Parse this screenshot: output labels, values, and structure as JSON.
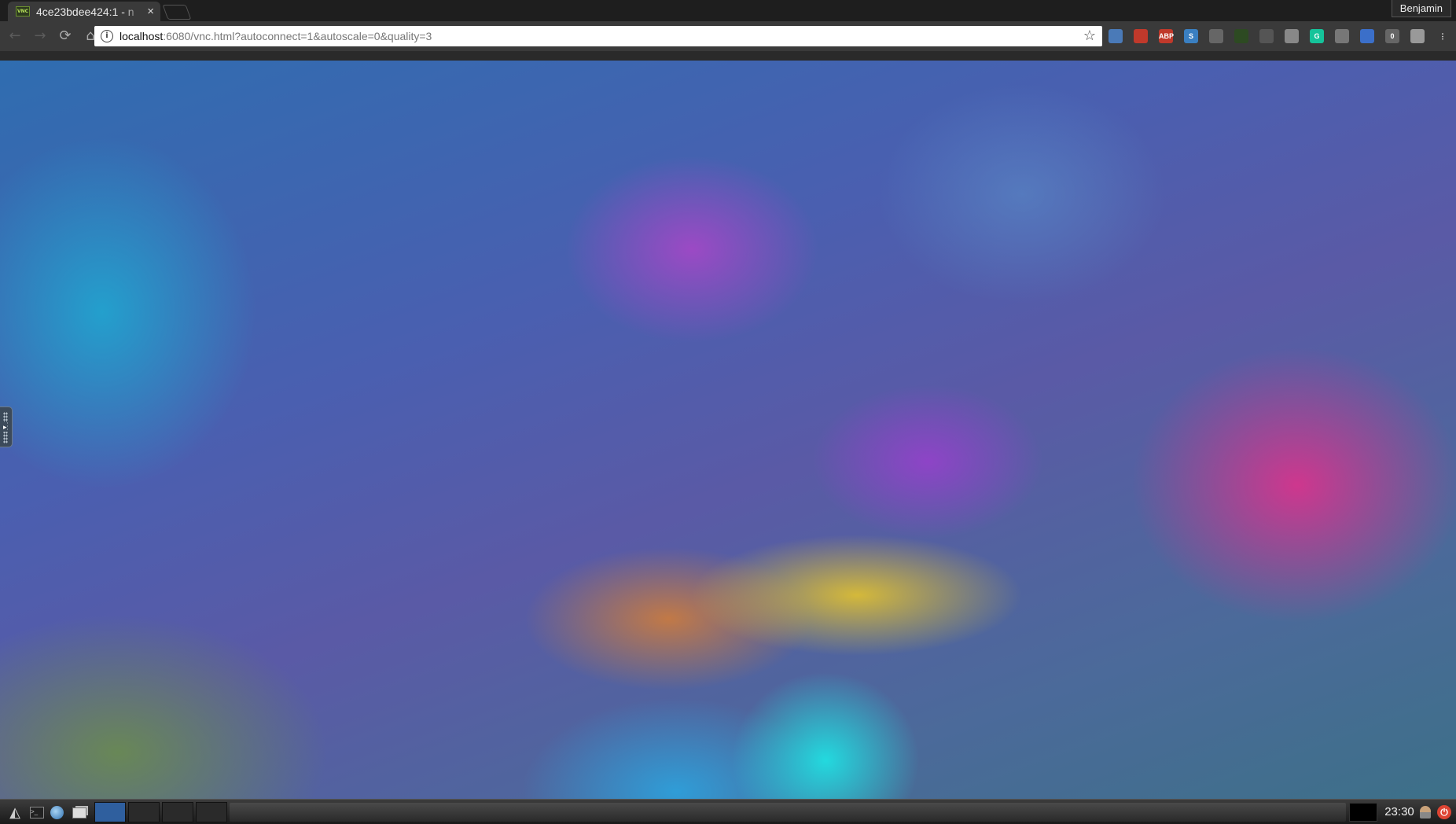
{
  "browser": {
    "tab": {
      "favicon_text": "VNC",
      "title": "4ce23bdee424:1 - n",
      "close_glyph": "×"
    },
    "profile_name": "Benjamin",
    "address_bar": {
      "url_host": "localhost",
      "url_rest": ":6080/vnc.html?autoconnect=1&autoscale=0&quality=3"
    },
    "nav": {
      "back": "←",
      "forward": "→",
      "reload": "⟳",
      "home": "⌂"
    },
    "bookmark_glyph": "☆",
    "extensions": [
      {
        "name": "printer-icon",
        "color": "#4a7ab8",
        "label": ""
      },
      {
        "name": "ublock-icon",
        "color": "#c0392b",
        "label": ""
      },
      {
        "name": "adblock-plus-icon",
        "color": "#c0392b",
        "label": "ABP"
      },
      {
        "name": "s-extension-icon",
        "color": "#3a7fc1",
        "label": "S"
      },
      {
        "name": "gear-extension-icon",
        "color": "#666666",
        "label": ""
      },
      {
        "name": "terminal-extension-icon",
        "color": "#2d4a22",
        "label": ""
      },
      {
        "name": "android-icon",
        "color": "#555555",
        "label": ""
      },
      {
        "name": "camera-icon",
        "color": "#888888",
        "label": ""
      },
      {
        "name": "grammarly-icon",
        "color": "#15c39a",
        "label": "G"
      },
      {
        "name": "circle-extension-icon",
        "color": "#777777",
        "label": ""
      },
      {
        "name": "pen-extension-icon",
        "color": "#3b6fc9",
        "label": ""
      },
      {
        "name": "zero-badge-icon",
        "color": "#666666",
        "label": "0"
      },
      {
        "name": "shield-extension-icon",
        "color": "#999999",
        "label": ""
      },
      {
        "name": "menu-dots-icon",
        "color": "#3a3a3a",
        "label": "⋮"
      }
    ]
  },
  "desktop": {
    "sidebar_arrow": "▸"
  },
  "taskbar": {
    "menu_glyph": "◭",
    "terminal_glyph": ">_",
    "clock": "23:30",
    "power_glyph": "⏻"
  }
}
